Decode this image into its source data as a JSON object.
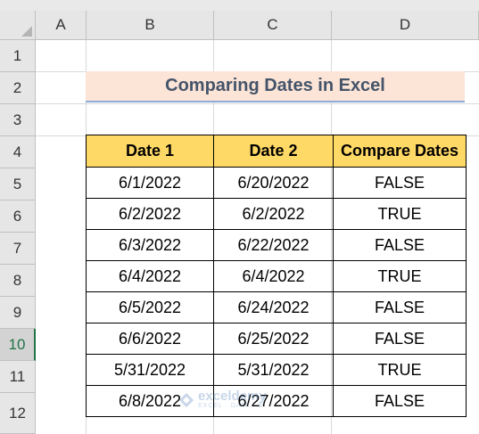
{
  "columns": [
    "A",
    "B",
    "C",
    "D"
  ],
  "rows": [
    "1",
    "2",
    "3",
    "4",
    "5",
    "6",
    "7",
    "8",
    "9",
    "10",
    "11",
    "12"
  ],
  "active_row": "10",
  "title": "Comparing Dates in Excel",
  "table": {
    "headers": [
      "Date 1",
      "Date 2",
      "Compare Dates"
    ],
    "rows": [
      [
        "6/1/2022",
        "6/20/2022",
        "FALSE"
      ],
      [
        "6/2/2022",
        "6/2/2022",
        "TRUE"
      ],
      [
        "6/3/2022",
        "6/22/2022",
        "FALSE"
      ],
      [
        "6/4/2022",
        "6/4/2022",
        "TRUE"
      ],
      [
        "6/5/2022",
        "6/24/2022",
        "FALSE"
      ],
      [
        "6/6/2022",
        "6/25/2022",
        "FALSE"
      ],
      [
        "5/31/2022",
        "5/31/2022",
        "TRUE"
      ],
      [
        "6/8/2022",
        "6/27/2022",
        "FALSE"
      ]
    ]
  },
  "watermark": {
    "brand": "exceldemy",
    "tagline": "EXCEL · DATA · BI"
  },
  "colors": {
    "title_fill": "#fce4d6",
    "header_fill": "#ffd966",
    "title_text": "#44546a",
    "accent": "#217346"
  }
}
